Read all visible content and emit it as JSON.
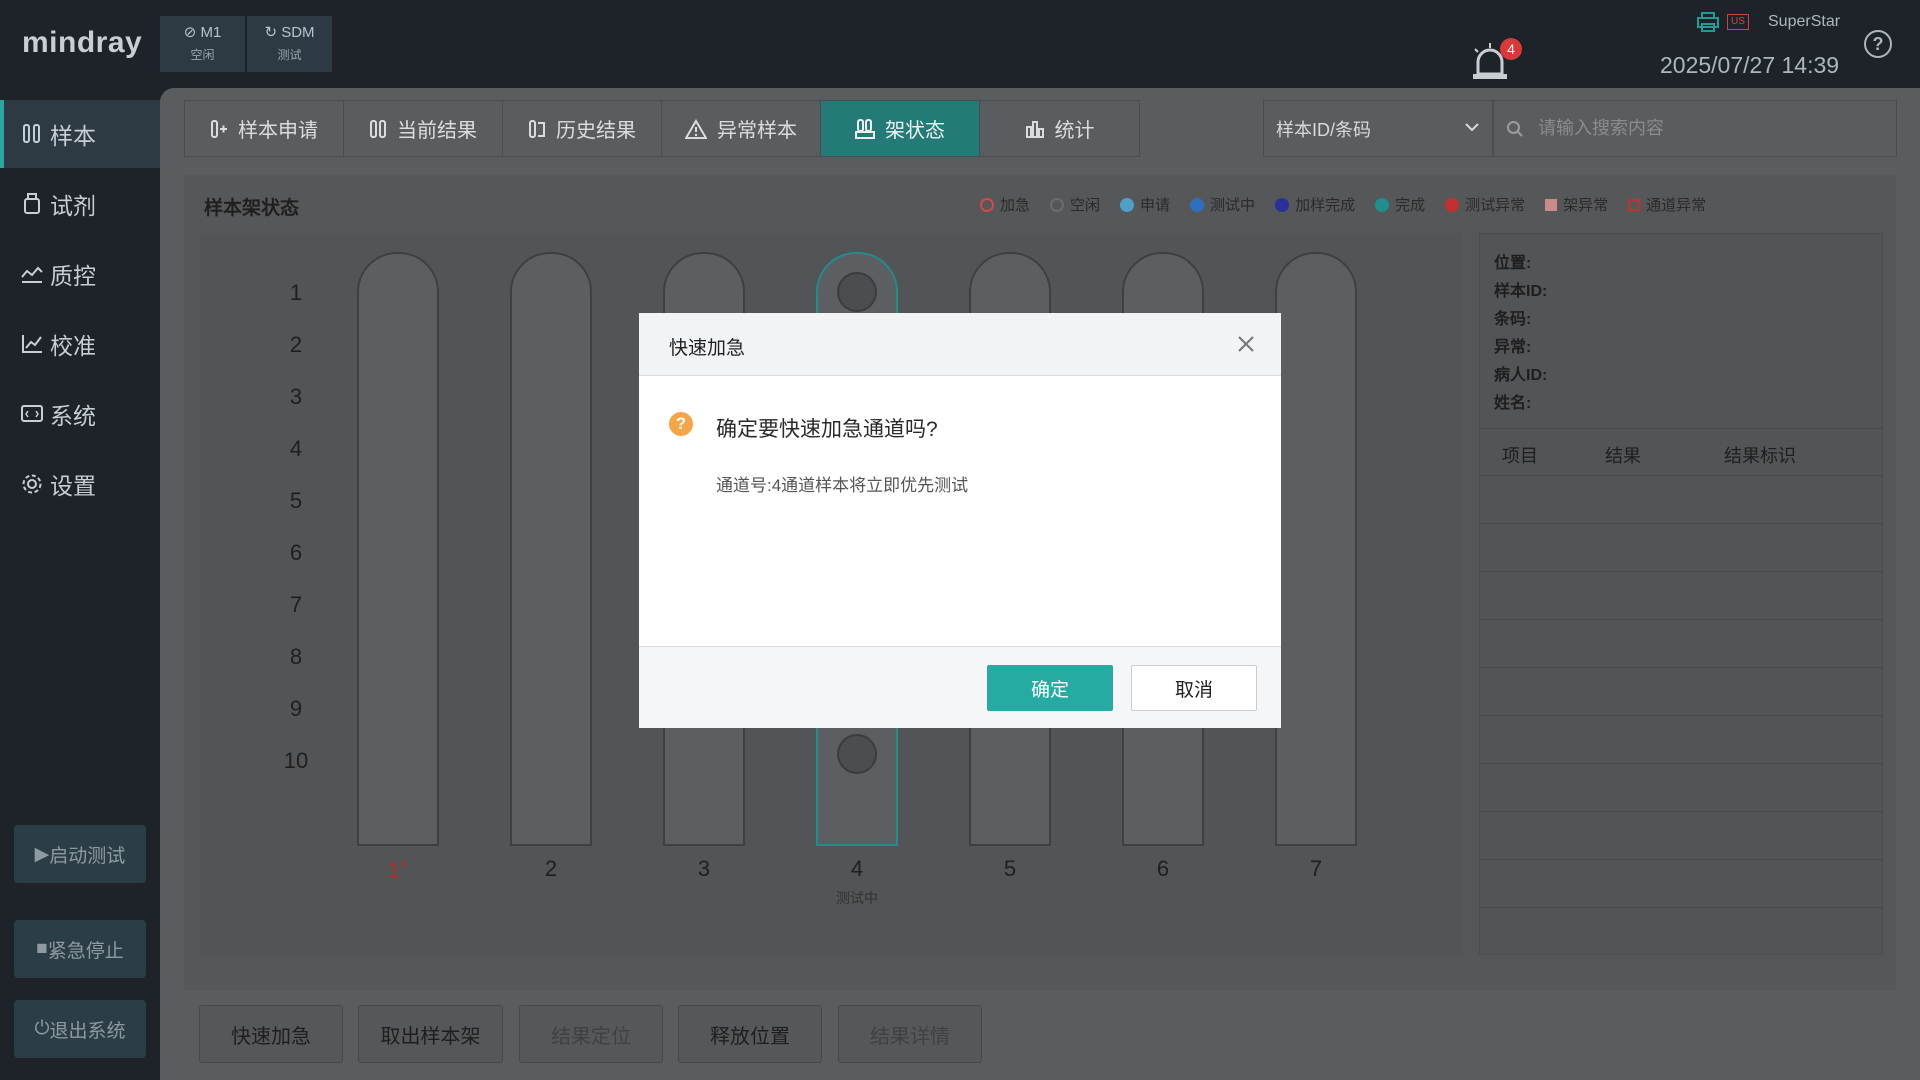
{
  "app": {
    "logo": "mindray",
    "user": "SuperStar",
    "datetime": "2025/07/27 14:39",
    "alarm_count": "4",
    "usb_label": "US"
  },
  "modules": [
    {
      "name": "M1",
      "status": "空闲"
    },
    {
      "name": "SDM",
      "status": "测试"
    }
  ],
  "sidebar": {
    "items": [
      {
        "label": "样本",
        "icon": "sample-tubes-icon",
        "active": true
      },
      {
        "label": "试剂",
        "icon": "reagent-bottle-icon"
      },
      {
        "label": "质控",
        "icon": "qc-chart-icon"
      },
      {
        "label": "校准",
        "icon": "calibration-chart-icon"
      },
      {
        "label": "系统",
        "icon": "system-monitor-icon"
      },
      {
        "label": "设置",
        "icon": "gear-icon"
      }
    ],
    "start_test": "启动测试",
    "emergency_stop": "紧急停止",
    "exit_system": "退出系统"
  },
  "tabs": [
    {
      "label": "样本申请",
      "icon": "tube-add-icon"
    },
    {
      "label": "当前结果",
      "icon": "tubes-icon"
    },
    {
      "label": "历史结果",
      "icon": "history-icon"
    },
    {
      "label": "异常样本",
      "icon": "warning-icon"
    },
    {
      "label": "架状态",
      "icon": "rack-icon",
      "active": true
    },
    {
      "label": "统计",
      "icon": "bar-chart-icon"
    }
  ],
  "search": {
    "type": "样本ID/条码",
    "placeholder": "请输入搜索内容"
  },
  "rack_panel": {
    "title": "样本架状态",
    "legend": [
      {
        "label": "加急",
        "shape": "ring",
        "color": "#d44a4a"
      },
      {
        "label": "空闲",
        "shape": "ring",
        "color": "#6a6d70"
      },
      {
        "label": "申请",
        "shape": "dot",
        "color": "#4ea0c8"
      },
      {
        "label": "测试中",
        "shape": "dot",
        "color": "#2f6fbf"
      },
      {
        "label": "加样完成",
        "shape": "dot",
        "color": "#2a2f9a"
      },
      {
        "label": "完成",
        "shape": "dot",
        "color": "#1e8f8a"
      },
      {
        "label": "测试异常",
        "shape": "dot",
        "color": "#c43030"
      },
      {
        "label": "架异常",
        "shape": "square",
        "color": "#c98a8a"
      },
      {
        "label": "通道异常",
        "shape": "square-outline",
        "color": "#c43030"
      }
    ],
    "row_numbers": [
      "1",
      "2",
      "3",
      "4",
      "5",
      "6",
      "7",
      "8",
      "9",
      "10"
    ],
    "racks": [
      {
        "label": "1",
        "urgent_mark": "+"
      },
      {
        "label": "2"
      },
      {
        "label": "3"
      },
      {
        "label": "4",
        "status": "测试中"
      },
      {
        "label": "5"
      },
      {
        "label": "6"
      },
      {
        "label": "7"
      }
    ]
  },
  "info": {
    "position": "位置:",
    "sample_id": "样本ID:",
    "barcode": "条码:",
    "abnormal": "异常:",
    "patient_id": "病人ID:",
    "name": "姓名:",
    "columns": [
      "项目",
      "结果",
      "结果标识"
    ]
  },
  "bottom_buttons": [
    "快速加急",
    "取出样本架",
    "结果定位",
    "释放位置",
    "结果详情"
  ],
  "dialog": {
    "title": "快速加急",
    "question": "确定要快速加急通道吗?",
    "detail": "通道号:4通道样本将立即优先测试",
    "confirm": "确定",
    "cancel": "取消"
  }
}
